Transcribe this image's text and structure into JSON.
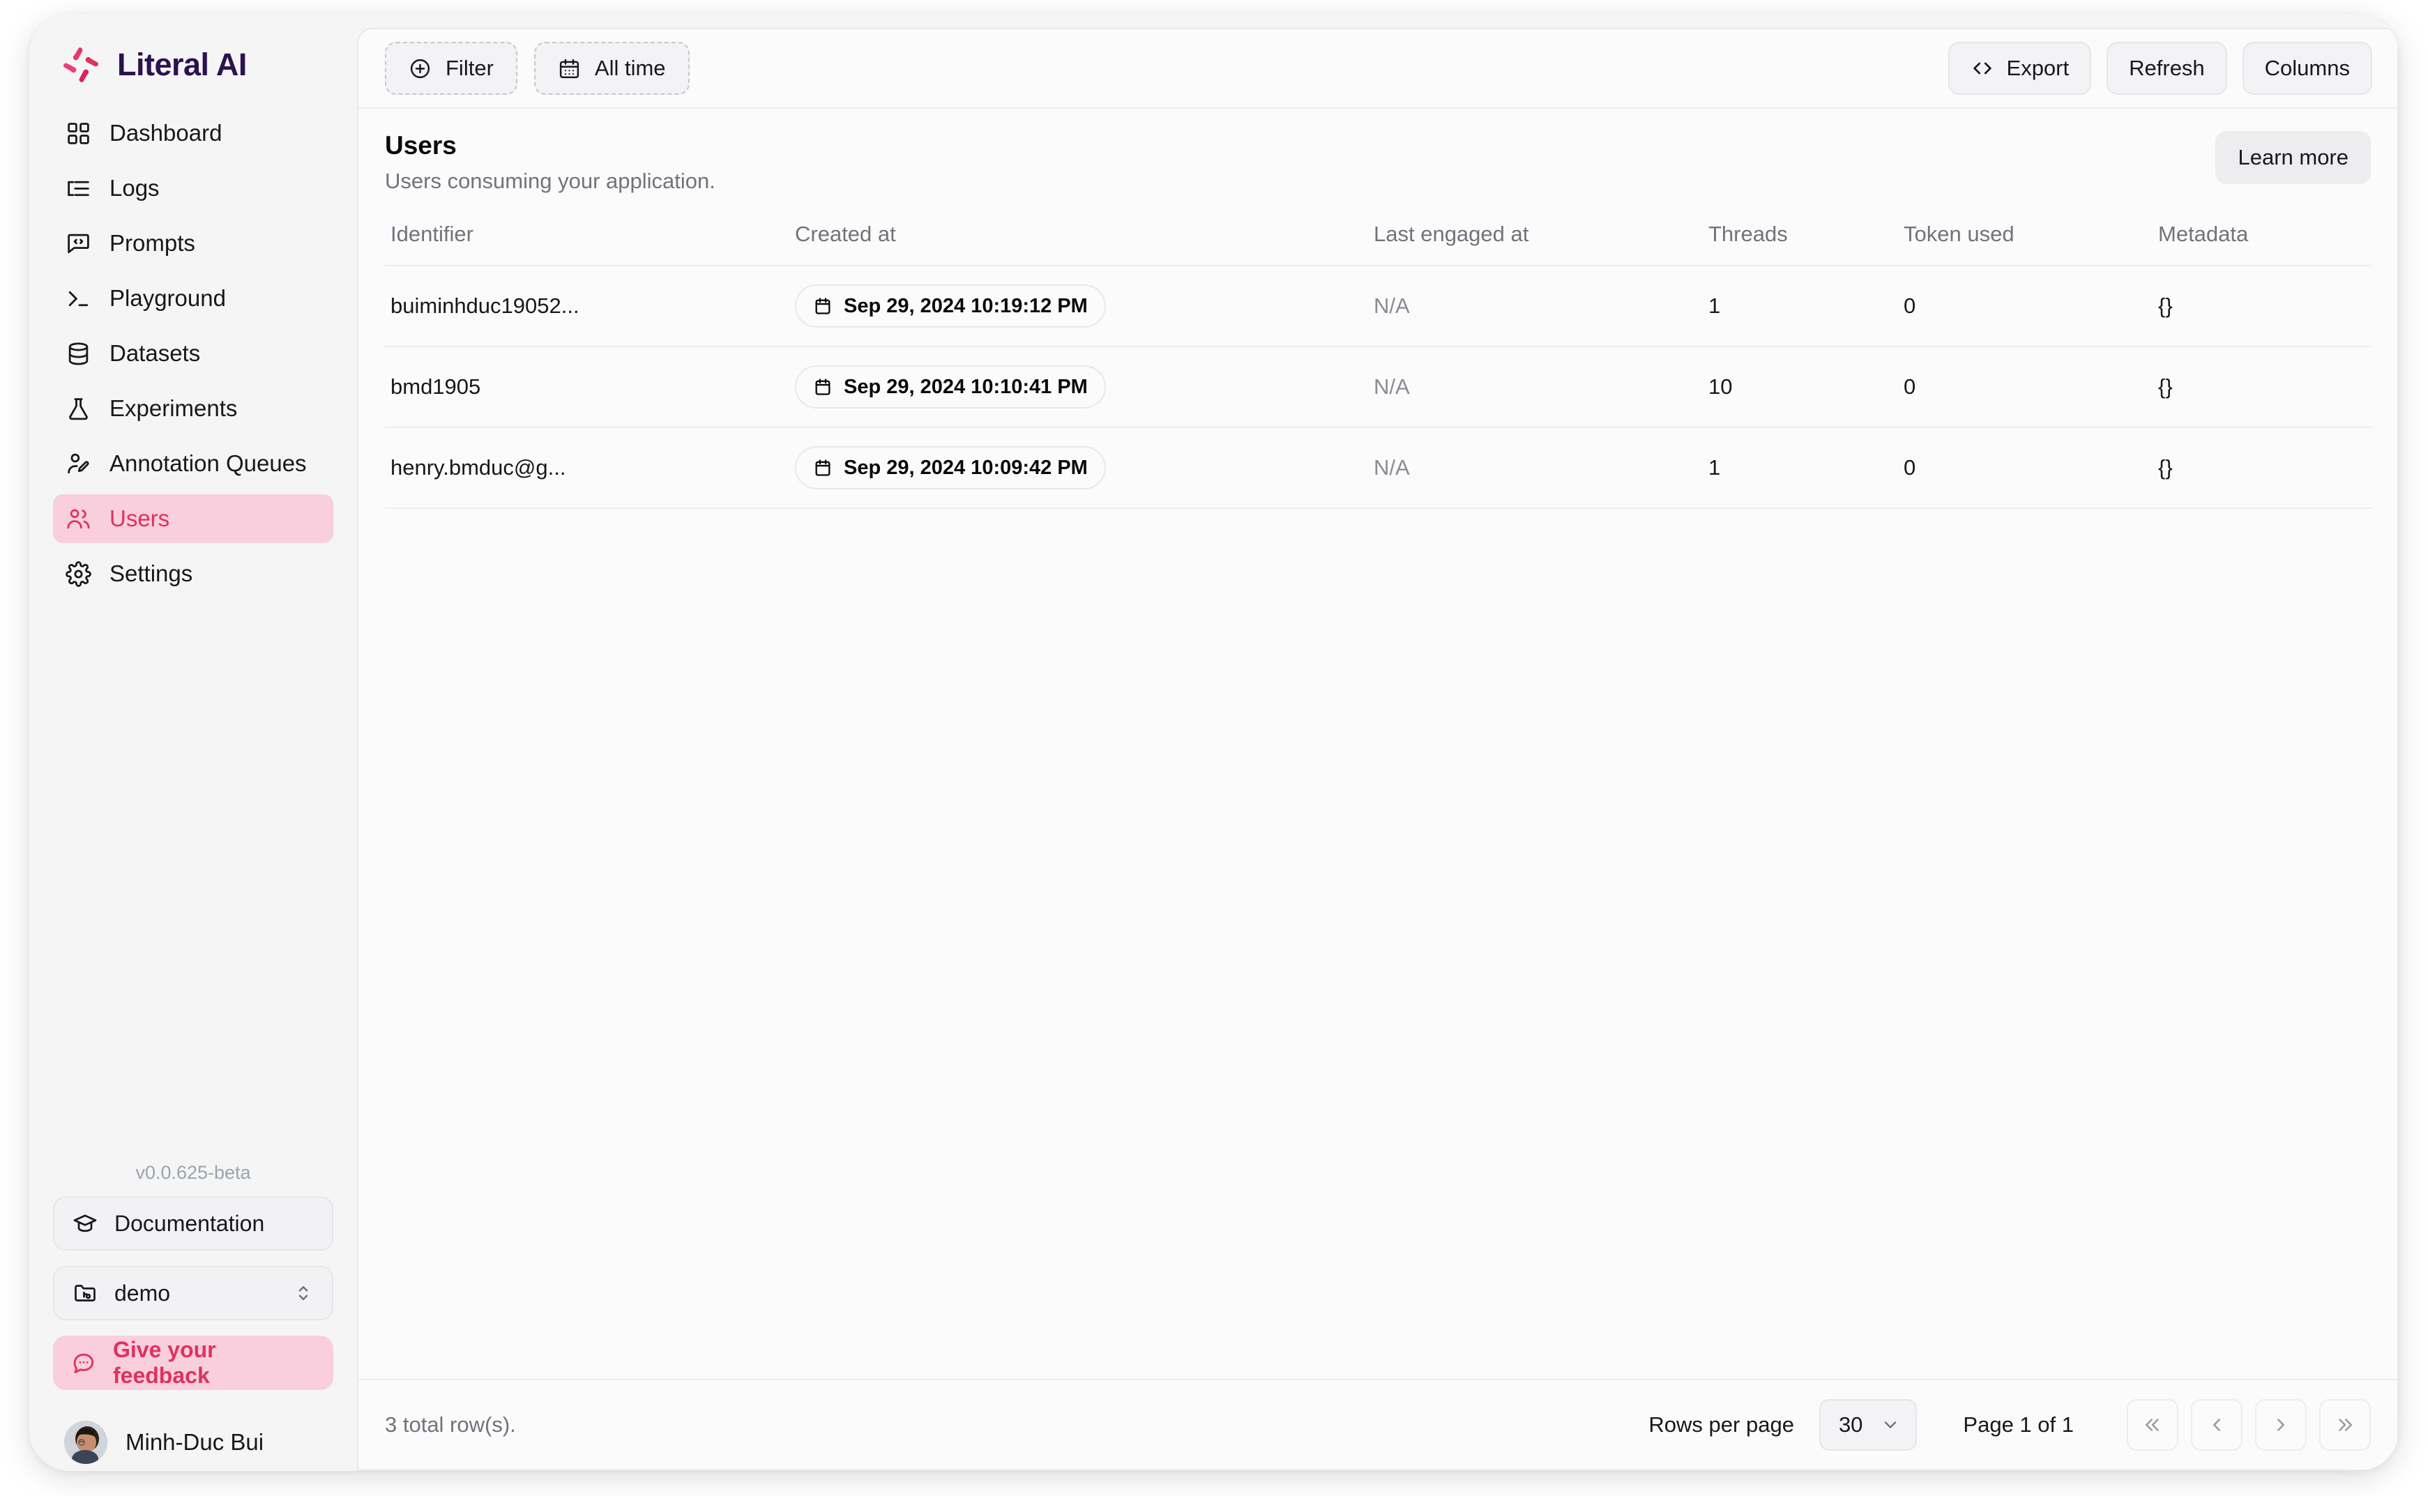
{
  "brand": {
    "name": "Literal AI",
    "logo_icon": "literal-ai-logo"
  },
  "sidebar": {
    "items": [
      {
        "label": "Dashboard",
        "icon": "grid-icon",
        "active": false
      },
      {
        "label": "Logs",
        "icon": "list-indent-icon",
        "active": false
      },
      {
        "label": "Prompts",
        "icon": "message-code-icon",
        "active": false
      },
      {
        "label": "Playground",
        "icon": "terminal-icon",
        "active": false
      },
      {
        "label": "Datasets",
        "icon": "database-icon",
        "active": false
      },
      {
        "label": "Experiments",
        "icon": "flask-icon",
        "active": false
      },
      {
        "label": "Annotation Queues",
        "icon": "user-pen-icon",
        "active": false
      },
      {
        "label": "Users",
        "icon": "users-icon",
        "active": true
      },
      {
        "label": "Settings",
        "icon": "gear-icon",
        "active": false
      }
    ],
    "version": "v0.0.625-beta",
    "documentation_label": "Documentation",
    "documentation_icon": "graduation-cap-icon",
    "project_label": "demo",
    "project_icon": "folder-git-icon",
    "project_chevron_icon": "chevron-up-down-icon",
    "feedback_label": "Give your feedback",
    "feedback_icon": "message-dots-icon",
    "user_name": "Minh-Duc Bui",
    "user_avatar_icon": "avatar"
  },
  "toolbar": {
    "filter_label": "Filter",
    "filter_icon": "plus-circle-icon",
    "time_label": "All time",
    "time_icon": "calendar-icon",
    "export_label": "Export",
    "export_icon": "code-brackets-icon",
    "refresh_label": "Refresh",
    "columns_label": "Columns"
  },
  "page": {
    "title": "Users",
    "subtitle": "Users consuming your application.",
    "learn_more_label": "Learn more"
  },
  "table": {
    "columns": [
      "Identifier",
      "Created at",
      "Last engaged at",
      "Threads",
      "Token used",
      "Metadata"
    ],
    "rows": [
      {
        "identifier": "buiminhduc19052...",
        "created_at": "Sep 29, 2024 10:19:12 PM",
        "last_engaged_at": "N/A",
        "threads": "1",
        "token_used": "0",
        "metadata": "{}"
      },
      {
        "identifier": "bmd1905",
        "created_at": "Sep 29, 2024 10:10:41 PM",
        "last_engaged_at": "N/A",
        "threads": "10",
        "token_used": "0",
        "metadata": "{}"
      },
      {
        "identifier": "henry.bmduc@g...",
        "created_at": "Sep 29, 2024 10:09:42 PM",
        "last_engaged_at": "N/A",
        "threads": "1",
        "token_used": "0",
        "metadata": "{}"
      }
    ]
  },
  "footer": {
    "total_rows": "3 total row(s).",
    "rows_per_page_label": "Rows per page",
    "rows_per_page_value": "30",
    "page_label": "Page 1 of 1",
    "first_page_icon": "chevrons-left-icon",
    "prev_page_icon": "chevron-left-icon",
    "next_page_icon": "chevron-right-icon",
    "last_page_icon": "chevrons-right-icon"
  },
  "colors": {
    "accent_pink": "#e0315f",
    "accent_pink_bg": "#f9cfdd",
    "brand_purple": "#2c1250",
    "app_bg": "#f5f5f6",
    "panel_bg": "#fbfbfc",
    "border": "#ededf0",
    "muted_text": "#72727c"
  }
}
